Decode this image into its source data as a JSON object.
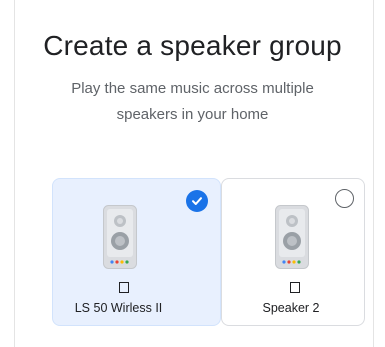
{
  "header": {
    "title": "Create a speaker group",
    "subtitle": "Play the same music across multiple speakers in your home"
  },
  "speakers": [
    {
      "name": "LS 50 Wirless II",
      "selected": true
    },
    {
      "name": "Speaker 2",
      "selected": false
    }
  ],
  "colors": {
    "accent": "#1a73e8",
    "selected_card_bg": "#e8f0fe",
    "speaker_body": "#dadce0",
    "speaker_cone": "#9aa0a6",
    "dot_blue": "#4285f4",
    "dot_red": "#ea4335",
    "dot_yellow": "#fbbc04",
    "dot_green": "#34a853"
  },
  "icons": {
    "selected_mark": "checkmark-circle-icon",
    "unselected_mark": "radio-circle-icon",
    "device": "speaker-icon",
    "missing_glyph": "tofu-glyph"
  }
}
